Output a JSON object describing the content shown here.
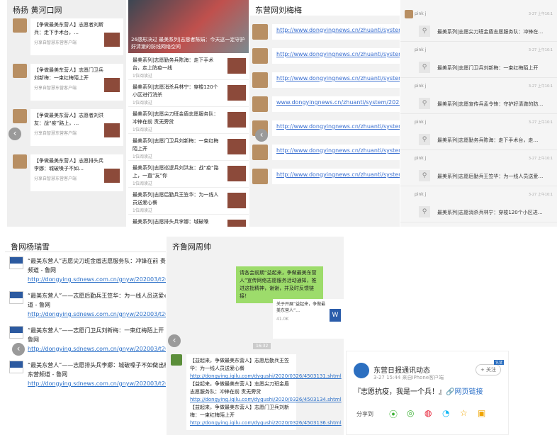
{
  "p1": {
    "title": "杨扬 黄河口网",
    "items": [
      {
        "text": "【争做最美东营人】志愿者刘斯兵：走下手术台，…",
        "sub": "分享自智慧东营客户端"
      },
      {
        "text": "【争做最美东营人】志愿门卫兵刘新梅：一束红梅陌上开",
        "sub": "分享自智慧东营客户端"
      },
      {
        "text": "【争做最美东营人】志愿者刘洪友：战“疫”路上，…",
        "sub": "分享自智慧东营客户端"
      },
      {
        "text": "【争做最美东营人】志愿排头兵李娜：城破嗓子不如…",
        "sub": "分享自智慧东营客户端"
      }
    ]
  },
  "p2": {
    "hero": "26感形决过 最美系列|志愿者陈娟：今天这一定守护好清澈的防线网络空间",
    "items": [
      {
        "text": "最美系列|志愿勤务兵陈海：走下手术台，走上防疫一线",
        "sub": "1位阅读过"
      },
      {
        "text": "最美系列|志愿消杀兵林宁：穿梭120个小区进行消杀",
        "sub": "1位阅读过"
      },
      {
        "text": "最美系列|志愿尖刀班金盾志愿服务队：冲锋在前 责无旁贷",
        "sub": "1位阅读过"
      },
      {
        "text": "最美系列|志愿门卫兵刘新梅：一束红梅陌上开",
        "sub": "1位阅读过"
      },
      {
        "text": "最美系列|志愿巡逻兵刘洪友：战“疫”路上，一直“友”你",
        "sub": "1位阅读过"
      },
      {
        "text": "最美系列|志愿后勤兵王笠华：为一线人员送爱心餐",
        "sub": "1位阅读过"
      },
      {
        "text": "最美系列|志愿排头兵李娜：城破嗓",
        "sub": ""
      }
    ]
  },
  "p3": {
    "title": "东营网刘梅梅",
    "links": [
      "http://www.dongyingnews.cn/zhuanti/system/2020/03/27/010731029.shtml",
      "http://www.dongyingnews.cn/zhuanti/system/2020/03/27/010731030.shtml",
      "http://www.dongyingnews.cn/zhuanti/system/2020/03/27/010731031.shtml",
      "www.dongyingnews.cn/zhuanti/system/2020/03/27/010731024.shtml",
      "http://www.dongyingnews.cn/zhuanti/system/2020/03/27/010731026.shtml",
      "http://www.dongyingnews.cn/zhuanti/system/2020/03/27/010731027.shtml",
      "http://www.dongyingnews.cn/zhuanti/system/2020/03/27/010731025.shtml"
    ]
  },
  "p4": {
    "items": [
      {
        "user": "pink j",
        "time": "3-27 上午10:1",
        "text": "最美系列|志愿尖刀班金盾志愿服务队：冲锋在…"
      },
      {
        "user": "pink j",
        "time": "3-27 上午10:1",
        "text": "最美系列|志愿门卫兵刘新梅：一束红梅陌上开"
      },
      {
        "user": "pink j",
        "time": "3-27 上午10:1",
        "text": "最美系列|志愿宣传兵孟令锋：守护好清澈的防…"
      },
      {
        "user": "pink j",
        "time": "3-27 上午10:1",
        "text": "最美系列|志愿勤务兵陈海：走下手术台，走…"
      },
      {
        "user": "pink j",
        "time": "3-27 上午10:1",
        "text": "最美系列|志愿后勤兵王笠华：为一线人员送爱…"
      },
      {
        "user": "pink j",
        "time": "3-27 上午10:1",
        "text": "最美系列|志愿消杀兵林宁：穿梭120个小区进…"
      }
    ]
  },
  "p5": {
    "title": "鲁网杨瑞雪",
    "items": [
      {
        "text": "“最美东营人”志愿尖刀班金盾志愿服务队：冲锋在前 责无旁贷 - 东营新闻 - 东营频道 - 鲁网 ",
        "url": "http://dongying.sdnews.com.cn/gnyw/202003/t20200326_2708220.htm"
      },
      {
        "text": "“最美东营人”——志愿后勤兵王笠华：为一线人员送爱心餐 - 东营新闻 - 东营频道 - 鲁网 ",
        "url": "http://dongying.sdnews.com.cn/gnyw/202003/t20200326_2708230.htm"
      },
      {
        "text": "“最美东营人”——志愿门卫兵刘新梅：一束红梅陌上开 - 东营新闻 - 东营频道 - 鲁网 ",
        "url": "http://dongying.sdnews.com.cn/gnyw/202003/t20200326_2708242.htm"
      },
      {
        "text": "“最美东营人”——志愿排头兵李娜：城破嗓子不如做出样子 - 东营新闻 - 东营频道 - 鲁网 ",
        "url": "http://dongying.sdnews.com.cn/gnyw/202003/t20200326_2708..."
      }
    ]
  },
  "p6": {
    "title": "齐鲁网周帅",
    "green": "请各会前期“益起来，争做最美东营人”宣传网络志愿服务活动通知，推进这批精神，谢谢，并及时反馈链接！",
    "file_title": "关于开展“益起来，争做最美东营人”…",
    "file_size": "41.0K",
    "timestamp": "16:32",
    "reply": "【益起来，争做最美东营人】志愿后勤兵王笠华：为一线人员送爱心餐 ",
    "reply_url1": "http://dongying.iqilu.com/dygushi/2020/0326/4503131.shtml",
    "reply_mid": "【益起来，争做最美东营人】志愿尖刀班金盾志愿服务队：冲锋在前 责无旁贷 ",
    "reply_url2": "http://dongying.iqilu.com/dygushi/2020/0326/4503134.shtml",
    "reply_end": "【益起来，争做最美东营人】志愿门卫兵刘新梅：一束红梅陌上开 ",
    "reply_url3": "http://dongying.iqilu.com/dygushi/2020/0326/4503136.shtml"
  },
  "p7": {
    "name": "东营日报通讯动态",
    "time": "3-27 15:44  来自iPhone客户端",
    "follow": "+ 关注",
    "badge": "认证",
    "post": "『志愿抗疫，我是一个兵！』",
    "link": "网页链接",
    "share": "分享到"
  }
}
